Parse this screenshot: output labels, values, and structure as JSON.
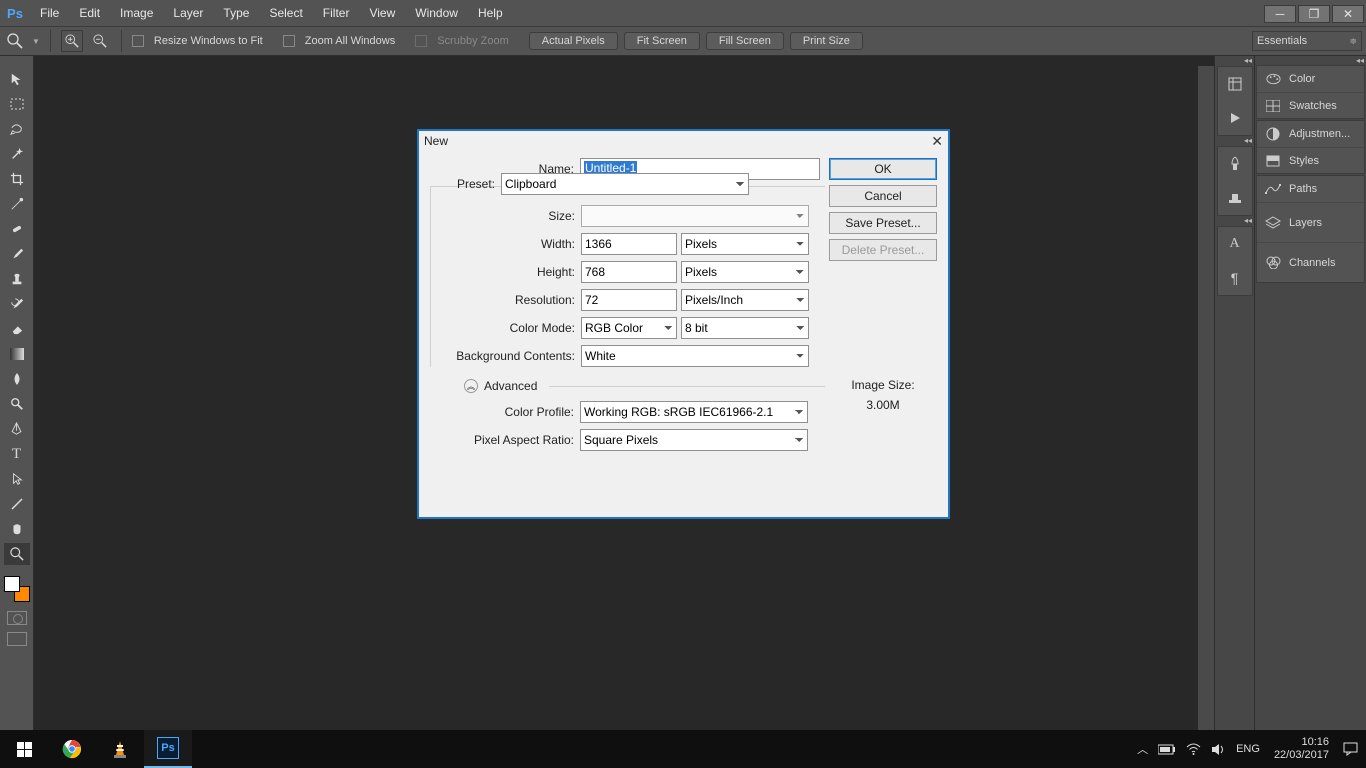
{
  "menu": {
    "items": [
      "File",
      "Edit",
      "Image",
      "Layer",
      "Type",
      "Select",
      "Filter",
      "View",
      "Window",
      "Help"
    ],
    "logo": "Ps"
  },
  "optbar": {
    "resize": "Resize Windows to Fit",
    "zoomall": "Zoom All Windows",
    "scrubby": "Scrubby Zoom",
    "b1": "Actual Pixels",
    "b2": "Fit Screen",
    "b3": "Fill Screen",
    "b4": "Print Size",
    "workspace": "Essentials"
  },
  "panels": {
    "color": "Color",
    "swatches": "Swatches",
    "adjustments": "Adjustmen...",
    "styles": "Styles",
    "paths": "Paths",
    "layers": "Layers",
    "channels": "Channels"
  },
  "dialog": {
    "title": "New",
    "name_label": "Name:",
    "name_value": "Untitled-1",
    "preset_label": "Preset:",
    "preset_value": "Clipboard",
    "size_label": "Size:",
    "width_label": "Width:",
    "width_value": "1366",
    "width_unit": "Pixels",
    "height_label": "Height:",
    "height_value": "768",
    "height_unit": "Pixels",
    "res_label": "Resolution:",
    "res_value": "72",
    "res_unit": "Pixels/Inch",
    "mode_label": "Color Mode:",
    "mode_value": "RGB Color",
    "depth": "8 bit",
    "bg_label": "Background Contents:",
    "bg_value": "White",
    "adv_label": "Advanced",
    "profile_label": "Color Profile:",
    "profile_value": "Working RGB:  sRGB IEC61966-2.1",
    "par_label": "Pixel Aspect Ratio:",
    "par_value": "Square Pixels",
    "ok": "OK",
    "cancel": "Cancel",
    "save": "Save Preset...",
    "delete": "Delete Preset...",
    "imgsize_label": "Image Size:",
    "imgsize_value": "3.00M"
  },
  "taskbar": {
    "lang": "ENG",
    "time": "10:16",
    "date": "22/03/2017"
  }
}
